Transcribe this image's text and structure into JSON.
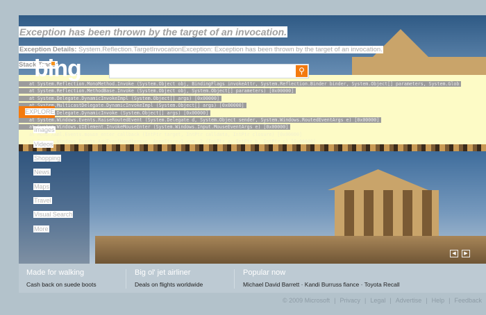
{
  "error": {
    "title": "Exception has been thrown by the target of an invocation.",
    "details_label": "Exception Details:",
    "details_text": "System.Reflection.TargetInvocationException: Exception has been thrown by the target of an invocation.",
    "stack_label": "Stack Trace:",
    "trace": [
      "at System.Reflection.MonoMethod.Invoke (System.Object obj, BindingFlags invokeAttr, System.Reflection.Binder binder, System.Object[] parameters, System.Glob",
      "at System.Reflection.MethodBase.Invoke (System.Object obj, System.Object[] parameters) [0x00000]",
      "at System.Delegate.DynamicInvokeImpl (System.Object[] args) [0x00000]",
      "at System.MulticastDelegate.DynamicInvokeImpl (System.Object[] args) [0x00000]",
      "at System.Delegate.DynamicInvoke (System.Object[] args) [0x00000]",
      "at System.Windows.Events.RaiseRoutedEvent (System.Delegate d, System.Object sender, System.Windows.RoutedEventArgs e) [0x00000]",
      "at System.Windows.UIElement.InvokeMouseEnter (System.Windows.Input.MouseEventArgs e) [0x00000]",
      "at Mono.Xaml.Events.mouse_enter_callback (IntPtr target, IntPtr calldata, IntPtr closure) [0x00000]",
      "at System.Windows.Events.AddEventHandlers>c__AnonStorey1.<>m__2 (IntPtr a, IntPtr b, IntPtr c) [0x00000]"
    ]
  },
  "logo": "bing",
  "search": {
    "placeholder": "",
    "icon": "search-icon"
  },
  "nav": {
    "explore": "EXPLORE",
    "items": [
      "Images",
      "Videos",
      "Shopping",
      "News",
      "Maps",
      "Travel",
      "Visual Search",
      "More"
    ]
  },
  "promos": [
    {
      "title": "Made for walking",
      "sub": "Cash back on suede boots"
    },
    {
      "title": "Big ol' jet airliner",
      "sub": "Deals on flights worldwide"
    },
    {
      "title": "Popular now",
      "sub": "Michael David Barrett · Kandi Burruss fiance · Toyota Recall"
    }
  ],
  "footer": [
    "© 2009 Microsoft",
    "|",
    "Privacy",
    "|",
    "Legal",
    "|",
    "Advertise",
    "|",
    "Help",
    "|",
    "Feedback"
  ],
  "colors": {
    "accent": "#f47a0e",
    "bottom_bar": "#bdcad3"
  }
}
